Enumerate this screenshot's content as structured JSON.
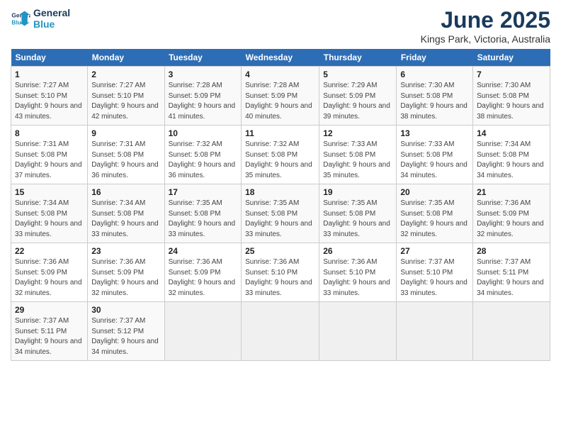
{
  "header": {
    "logo_line1": "General",
    "logo_line2": "Blue",
    "month": "June 2025",
    "location": "Kings Park, Victoria, Australia"
  },
  "days_of_week": [
    "Sunday",
    "Monday",
    "Tuesday",
    "Wednesday",
    "Thursday",
    "Friday",
    "Saturday"
  ],
  "weeks": [
    [
      {
        "num": "1",
        "sunrise": "7:27 AM",
        "sunset": "5:10 PM",
        "daylight": "9 hours and 43 minutes."
      },
      {
        "num": "2",
        "sunrise": "7:27 AM",
        "sunset": "5:10 PM",
        "daylight": "9 hours and 42 minutes."
      },
      {
        "num": "3",
        "sunrise": "7:28 AM",
        "sunset": "5:09 PM",
        "daylight": "9 hours and 41 minutes."
      },
      {
        "num": "4",
        "sunrise": "7:28 AM",
        "sunset": "5:09 PM",
        "daylight": "9 hours and 40 minutes."
      },
      {
        "num": "5",
        "sunrise": "7:29 AM",
        "sunset": "5:09 PM",
        "daylight": "9 hours and 39 minutes."
      },
      {
        "num": "6",
        "sunrise": "7:30 AM",
        "sunset": "5:08 PM",
        "daylight": "9 hours and 38 minutes."
      },
      {
        "num": "7",
        "sunrise": "7:30 AM",
        "sunset": "5:08 PM",
        "daylight": "9 hours and 38 minutes."
      }
    ],
    [
      {
        "num": "8",
        "sunrise": "7:31 AM",
        "sunset": "5:08 PM",
        "daylight": "9 hours and 37 minutes."
      },
      {
        "num": "9",
        "sunrise": "7:31 AM",
        "sunset": "5:08 PM",
        "daylight": "9 hours and 36 minutes."
      },
      {
        "num": "10",
        "sunrise": "7:32 AM",
        "sunset": "5:08 PM",
        "daylight": "9 hours and 36 minutes."
      },
      {
        "num": "11",
        "sunrise": "7:32 AM",
        "sunset": "5:08 PM",
        "daylight": "9 hours and 35 minutes."
      },
      {
        "num": "12",
        "sunrise": "7:33 AM",
        "sunset": "5:08 PM",
        "daylight": "9 hours and 35 minutes."
      },
      {
        "num": "13",
        "sunrise": "7:33 AM",
        "sunset": "5:08 PM",
        "daylight": "9 hours and 34 minutes."
      },
      {
        "num": "14",
        "sunrise": "7:34 AM",
        "sunset": "5:08 PM",
        "daylight": "9 hours and 34 minutes."
      }
    ],
    [
      {
        "num": "15",
        "sunrise": "7:34 AM",
        "sunset": "5:08 PM",
        "daylight": "9 hours and 33 minutes."
      },
      {
        "num": "16",
        "sunrise": "7:34 AM",
        "sunset": "5:08 PM",
        "daylight": "9 hours and 33 minutes."
      },
      {
        "num": "17",
        "sunrise": "7:35 AM",
        "sunset": "5:08 PM",
        "daylight": "9 hours and 33 minutes."
      },
      {
        "num": "18",
        "sunrise": "7:35 AM",
        "sunset": "5:08 PM",
        "daylight": "9 hours and 33 minutes."
      },
      {
        "num": "19",
        "sunrise": "7:35 AM",
        "sunset": "5:08 PM",
        "daylight": "9 hours and 33 minutes."
      },
      {
        "num": "20",
        "sunrise": "7:35 AM",
        "sunset": "5:08 PM",
        "daylight": "9 hours and 32 minutes."
      },
      {
        "num": "21",
        "sunrise": "7:36 AM",
        "sunset": "5:09 PM",
        "daylight": "9 hours and 32 minutes."
      }
    ],
    [
      {
        "num": "22",
        "sunrise": "7:36 AM",
        "sunset": "5:09 PM",
        "daylight": "9 hours and 32 minutes."
      },
      {
        "num": "23",
        "sunrise": "7:36 AM",
        "sunset": "5:09 PM",
        "daylight": "9 hours and 32 minutes."
      },
      {
        "num": "24",
        "sunrise": "7:36 AM",
        "sunset": "5:09 PM",
        "daylight": "9 hours and 32 minutes."
      },
      {
        "num": "25",
        "sunrise": "7:36 AM",
        "sunset": "5:10 PM",
        "daylight": "9 hours and 33 minutes."
      },
      {
        "num": "26",
        "sunrise": "7:36 AM",
        "sunset": "5:10 PM",
        "daylight": "9 hours and 33 minutes."
      },
      {
        "num": "27",
        "sunrise": "7:37 AM",
        "sunset": "5:10 PM",
        "daylight": "9 hours and 33 minutes."
      },
      {
        "num": "28",
        "sunrise": "7:37 AM",
        "sunset": "5:11 PM",
        "daylight": "9 hours and 34 minutes."
      }
    ],
    [
      {
        "num": "29",
        "sunrise": "7:37 AM",
        "sunset": "5:11 PM",
        "daylight": "9 hours and 34 minutes."
      },
      {
        "num": "30",
        "sunrise": "7:37 AM",
        "sunset": "5:12 PM",
        "daylight": "9 hours and 34 minutes."
      },
      null,
      null,
      null,
      null,
      null
    ]
  ]
}
